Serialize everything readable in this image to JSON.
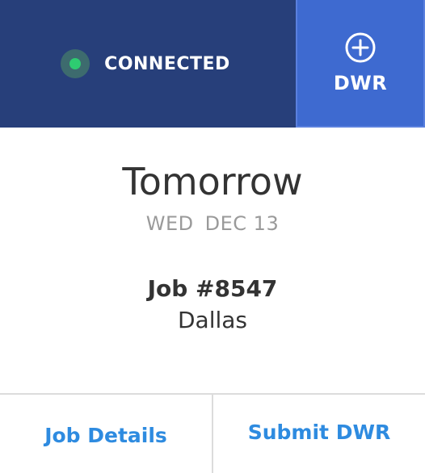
{
  "header": {
    "status_label": "CONNECTED",
    "status_color": "#2ecc71",
    "dwr_label": "DWR",
    "dwr_icon": "plus-circle-icon",
    "header_bg": "#273f7a",
    "dwr_bg": "#3e6ad0"
  },
  "schedule": {
    "day_title": "Tomorrow",
    "weekday": "WED",
    "date": "DEC 13"
  },
  "job": {
    "number": "Job #8547",
    "location": "Dallas"
  },
  "actions": {
    "job_details_label": "Job Details",
    "submit_dwr_label": "Submit DWR",
    "link_color": "#2e8be0"
  }
}
